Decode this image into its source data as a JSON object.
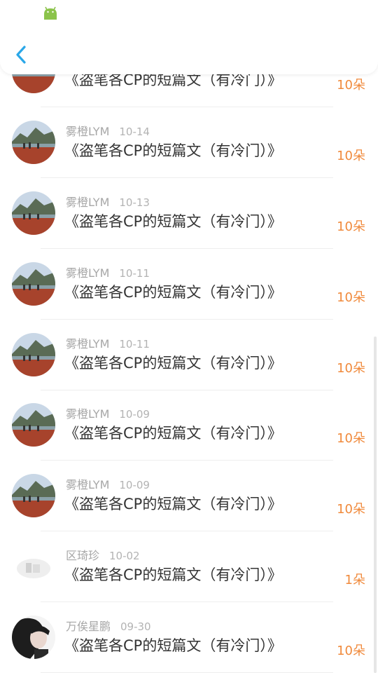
{
  "header": {
    "back_label": "<"
  },
  "rows": [
    {
      "user": "",
      "date": "",
      "title": "《盗笔各CP的短篇文（有冷门）》",
      "count": "10朵",
      "avatar": "landscape"
    },
    {
      "user": "雾橙LYM",
      "date": "10-14",
      "title": "《盗笔各CP的短篇文（有冷门）》",
      "count": "10朵",
      "avatar": "landscape"
    },
    {
      "user": "雾橙LYM",
      "date": "10-13",
      "title": "《盗笔各CP的短篇文（有冷门）》",
      "count": "10朵",
      "avatar": "landscape"
    },
    {
      "user": "雾橙LYM",
      "date": "10-11",
      "title": "《盗笔各CP的短篇文（有冷门）》",
      "count": "10朵",
      "avatar": "landscape"
    },
    {
      "user": "雾橙LYM",
      "date": "10-11",
      "title": "《盗笔各CP的短篇文（有冷门）》",
      "count": "10朵",
      "avatar": "landscape"
    },
    {
      "user": "雾橙LYM",
      "date": "10-09",
      "title": "《盗笔各CP的短篇文（有冷门）》",
      "count": "10朵",
      "avatar": "landscape"
    },
    {
      "user": "雾橙LYM",
      "date": "10-09",
      "title": "《盗笔各CP的短篇文（有冷门）》",
      "count": "10朵",
      "avatar": "landscape"
    },
    {
      "user": "区琦珍",
      "date": "10-02",
      "title": "《盗笔各CP的短篇文（有冷门）》",
      "count": "1朵",
      "avatar": "faded"
    },
    {
      "user": "万俟星鹏",
      "date": "09-30",
      "title": "《盗笔各CP的短篇文（有冷门）》",
      "count": "10朵",
      "avatar": "portrait"
    }
  ],
  "colors": {
    "accent": "#2aa7e8",
    "count": "#f08a3c",
    "android": "#8bc34a"
  }
}
